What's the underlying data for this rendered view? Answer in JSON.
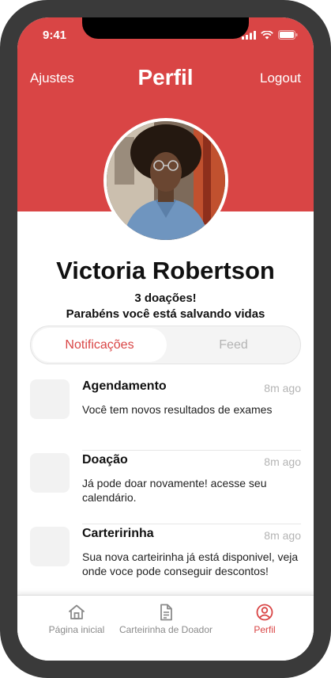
{
  "status_bar": {
    "time": "9:41"
  },
  "nav": {
    "left_label": "Ajustes",
    "title": "Perfil",
    "right_label": "Logout"
  },
  "profile": {
    "name": "Victoria Robertson",
    "donation_count": "3 doações!",
    "message": "Parabéns você está salvando vidas"
  },
  "segments": [
    {
      "label": "Notificações",
      "active": true
    },
    {
      "label": "Feed",
      "active": false
    }
  ],
  "notifications": [
    {
      "title": "Agendamento",
      "time": "8m ago",
      "body": "Você tem novos resultados de exames"
    },
    {
      "title": "Doação",
      "time": "8m ago",
      "body": "Já pode doar novamente! acesse seu calendário."
    },
    {
      "title": "Carteririnha",
      "time": "8m ago",
      "body": "Sua nova carteirinha já está disponivel, veja onde voce pode conseguir descontos!"
    }
  ],
  "tabbar": [
    {
      "label": "Página inicial",
      "icon": "home-icon"
    },
    {
      "label": "Carteirinha de Doador",
      "icon": "document-icon"
    },
    {
      "label": "Perfil",
      "icon": "profile-icon",
      "active": true
    }
  ],
  "colors": {
    "accent": "#d94545",
    "muted": "#b4b4b4"
  }
}
